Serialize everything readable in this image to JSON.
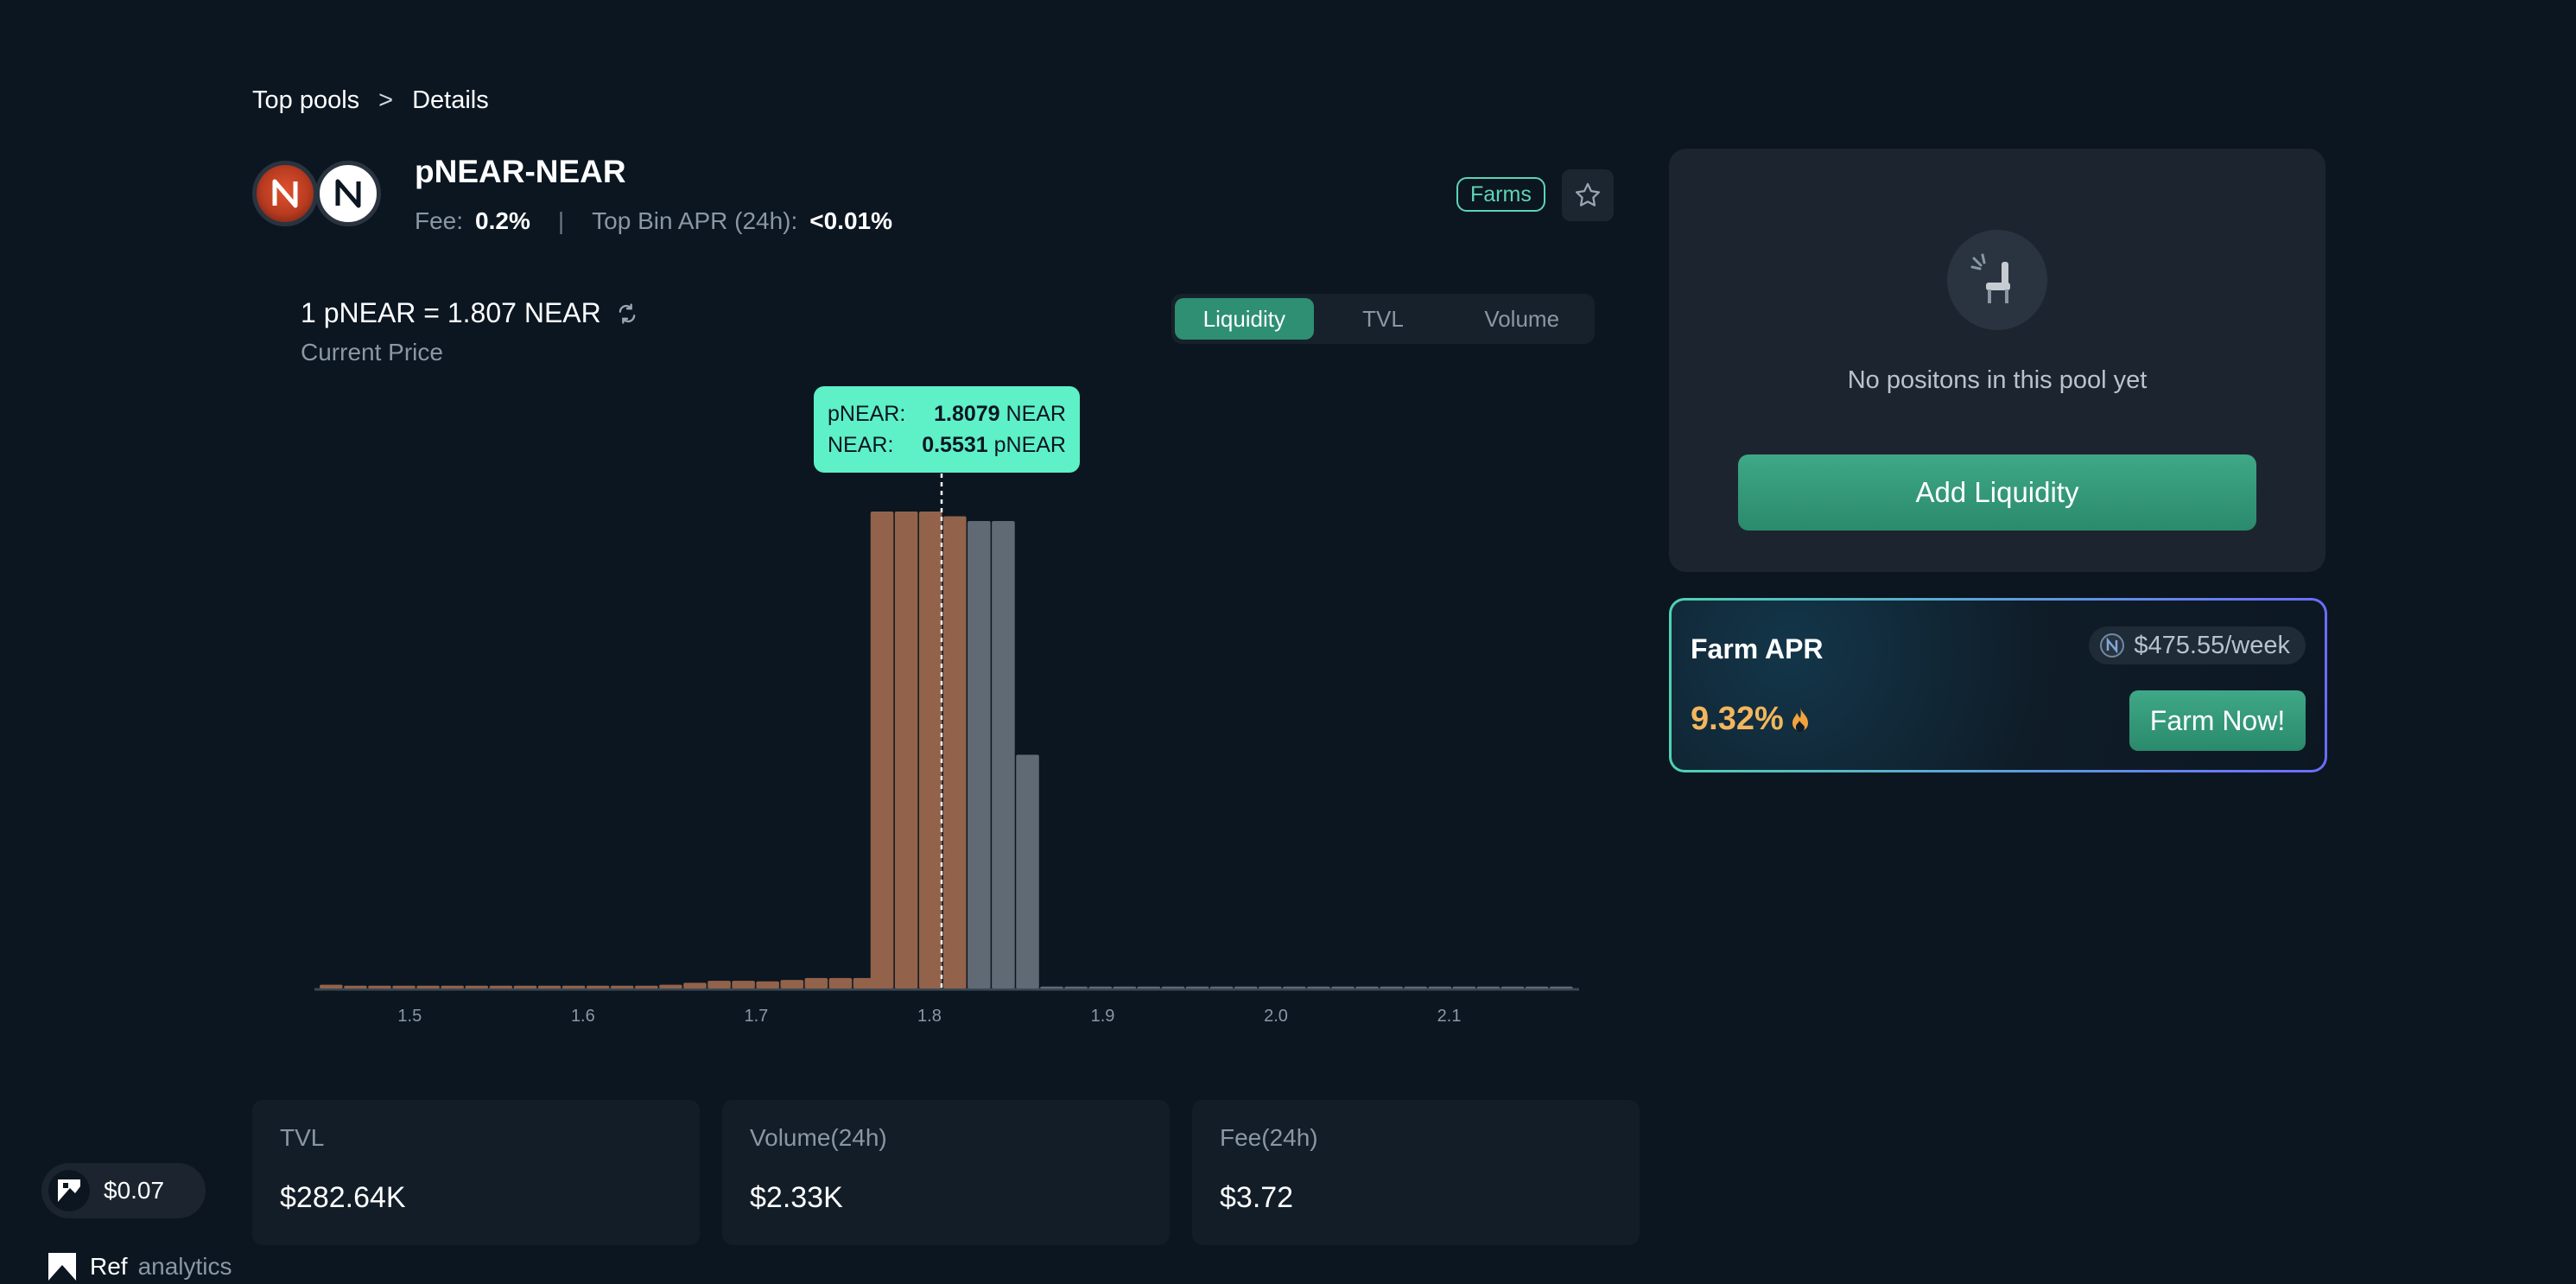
{
  "breadcrumb": {
    "root": "Top pools",
    "separator": ">",
    "current": "Details"
  },
  "pool": {
    "name": "pNEAR-NEAR",
    "fee_label": "Fee:",
    "fee_value": "0.2%",
    "apr_label": "Top Bin APR (24h):",
    "apr_value": "<0.01%",
    "farms_badge": "Farms"
  },
  "price": {
    "text": "1 pNEAR = 1.807 NEAR",
    "caption": "Current Price"
  },
  "tabs": [
    {
      "label": "Liquidity",
      "active": true
    },
    {
      "label": "TVL",
      "active": false
    },
    {
      "label": "Volume",
      "active": false
    }
  ],
  "tooltip": {
    "row1_label": "pNEAR:",
    "row1_value": "1.8079",
    "row1_unit": "NEAR",
    "row2_label": "NEAR:",
    "row2_value": "0.5531",
    "row2_unit": "pNEAR"
  },
  "chart_data": {
    "type": "bar",
    "xlim": [
      1.445,
      2.175
    ],
    "ylim": [
      0,
      1
    ],
    "current_price": 1.807,
    "colors": {
      "token_x": "#93624a",
      "token_y": "#5f6a74",
      "base": "#3a4854"
    },
    "ticks": [
      {
        "value": 1.5,
        "label": "1.5"
      },
      {
        "value": 1.6,
        "label": "1.6"
      },
      {
        "value": 1.7,
        "label": "1.7"
      },
      {
        "value": 1.8,
        "label": "1.8"
      },
      {
        "value": 1.9,
        "label": "1.9"
      },
      {
        "value": 2.0,
        "label": "2.0"
      },
      {
        "value": 2.1,
        "label": "2.1"
      }
    ],
    "bins": [
      {
        "price": 1.455,
        "value": 0.008,
        "token": "x"
      },
      {
        "price": 1.469,
        "value": 0.006,
        "token": "x"
      },
      {
        "price": 1.483,
        "value": 0.006,
        "token": "x"
      },
      {
        "price": 1.497,
        "value": 0.006,
        "token": "x"
      },
      {
        "price": 1.511,
        "value": 0.006,
        "token": "x"
      },
      {
        "price": 1.525,
        "value": 0.006,
        "token": "x"
      },
      {
        "price": 1.539,
        "value": 0.006,
        "token": "x"
      },
      {
        "price": 1.553,
        "value": 0.006,
        "token": "x"
      },
      {
        "price": 1.567,
        "value": 0.006,
        "token": "x"
      },
      {
        "price": 1.581,
        "value": 0.006,
        "token": "x"
      },
      {
        "price": 1.595,
        "value": 0.006,
        "token": "x"
      },
      {
        "price": 1.609,
        "value": 0.006,
        "token": "x"
      },
      {
        "price": 1.623,
        "value": 0.006,
        "token": "x"
      },
      {
        "price": 1.637,
        "value": 0.006,
        "token": "x"
      },
      {
        "price": 1.651,
        "value": 0.008,
        "token": "x"
      },
      {
        "price": 1.665,
        "value": 0.012,
        "token": "x"
      },
      {
        "price": 1.679,
        "value": 0.016,
        "token": "x"
      },
      {
        "price": 1.693,
        "value": 0.016,
        "token": "x"
      },
      {
        "price": 1.707,
        "value": 0.015,
        "token": "x"
      },
      {
        "price": 1.721,
        "value": 0.018,
        "token": "x"
      },
      {
        "price": 1.735,
        "value": 0.022,
        "token": "x"
      },
      {
        "price": 1.749,
        "value": 0.022,
        "token": "x"
      },
      {
        "price": 1.763,
        "value": 0.022,
        "token": "x"
      },
      {
        "price": 1.773,
        "value": 1.0,
        "token": "x"
      },
      {
        "price": 1.787,
        "value": 1.0,
        "token": "x"
      },
      {
        "price": 1.801,
        "value": 1.0,
        "token": "x"
      },
      {
        "price": 1.815,
        "value": 0.99,
        "token": "x"
      },
      {
        "price": 1.829,
        "value": 0.98,
        "token": "y"
      },
      {
        "price": 1.843,
        "value": 0.98,
        "token": "y"
      },
      {
        "price": 1.857,
        "value": 0.49,
        "token": "y"
      },
      {
        "price": 1.871,
        "value": 0.004,
        "token": "y"
      },
      {
        "price": 1.885,
        "value": 0.004,
        "token": "y"
      },
      {
        "price": 1.899,
        "value": 0.004,
        "token": "y"
      },
      {
        "price": 1.913,
        "value": 0.004,
        "token": "y"
      },
      {
        "price": 1.927,
        "value": 0.004,
        "token": "y"
      },
      {
        "price": 1.941,
        "value": 0.004,
        "token": "y"
      },
      {
        "price": 1.955,
        "value": 0.004,
        "token": "y"
      },
      {
        "price": 1.969,
        "value": 0.004,
        "token": "y"
      },
      {
        "price": 1.983,
        "value": 0.004,
        "token": "y"
      },
      {
        "price": 1.997,
        "value": 0.004,
        "token": "y"
      },
      {
        "price": 2.011,
        "value": 0.004,
        "token": "y"
      },
      {
        "price": 2.025,
        "value": 0.004,
        "token": "y"
      },
      {
        "price": 2.039,
        "value": 0.004,
        "token": "y"
      },
      {
        "price": 2.053,
        "value": 0.004,
        "token": "y"
      },
      {
        "price": 2.067,
        "value": 0.004,
        "token": "y"
      },
      {
        "price": 2.081,
        "value": 0.004,
        "token": "y"
      },
      {
        "price": 2.095,
        "value": 0.004,
        "token": "y"
      },
      {
        "price": 2.109,
        "value": 0.004,
        "token": "y"
      },
      {
        "price": 2.123,
        "value": 0.004,
        "token": "y"
      },
      {
        "price": 2.137,
        "value": 0.004,
        "token": "y"
      },
      {
        "price": 2.151,
        "value": 0.004,
        "token": "y"
      },
      {
        "price": 2.165,
        "value": 0.004,
        "token": "y"
      }
    ]
  },
  "stats": [
    {
      "label": "TVL",
      "value": "$282.64K"
    },
    {
      "label": "Volume(24h)",
      "value": "$2.33K"
    },
    {
      "label": "Fee(24h)",
      "value": "$3.72"
    }
  ],
  "positions": {
    "empty_text": "No positons in this pool yet",
    "add_button": "Add Liquidity"
  },
  "farm": {
    "title": "Farm APR",
    "reward": "$475.55/week",
    "apr": "9.32%",
    "button": "Farm Now!"
  },
  "ref": {
    "price": "$0.07",
    "footer_brand": "Ref",
    "footer_analytics": "analytics"
  },
  "colors": {
    "accent": "#2e8f72",
    "tooltip": "#5ef0c7",
    "apr": "#f2b65c",
    "background": "#0b1621"
  }
}
